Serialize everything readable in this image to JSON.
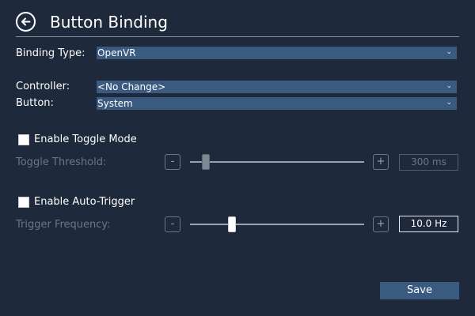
{
  "header": {
    "title": "Button Binding",
    "back_icon": "arrow-left-circle-icon"
  },
  "binding_type": {
    "label": "Binding Type:",
    "value": "OpenVR"
  },
  "controller": {
    "label": "Controller:",
    "value": "<No Change>"
  },
  "button": {
    "label": "Button:",
    "value": "System"
  },
  "toggle": {
    "checkbox_label": "Enable Toggle Mode",
    "checked": false,
    "threshold_label": "Toggle Threshold:",
    "minus": "-",
    "plus": "+",
    "slider_fraction": 0.07,
    "value": "300 ms"
  },
  "auto_trigger": {
    "checkbox_label": "Enable Auto-Trigger",
    "checked": false,
    "frequency_label": "Trigger Frequency:",
    "minus": "-",
    "plus": "+",
    "slider_fraction": 0.23,
    "value": "10.0 Hz"
  },
  "actions": {
    "save_label": "Save"
  },
  "colors": {
    "background": "#1e2a3b",
    "accent": "#3a5a80",
    "disabled_text": "#6b7585"
  }
}
